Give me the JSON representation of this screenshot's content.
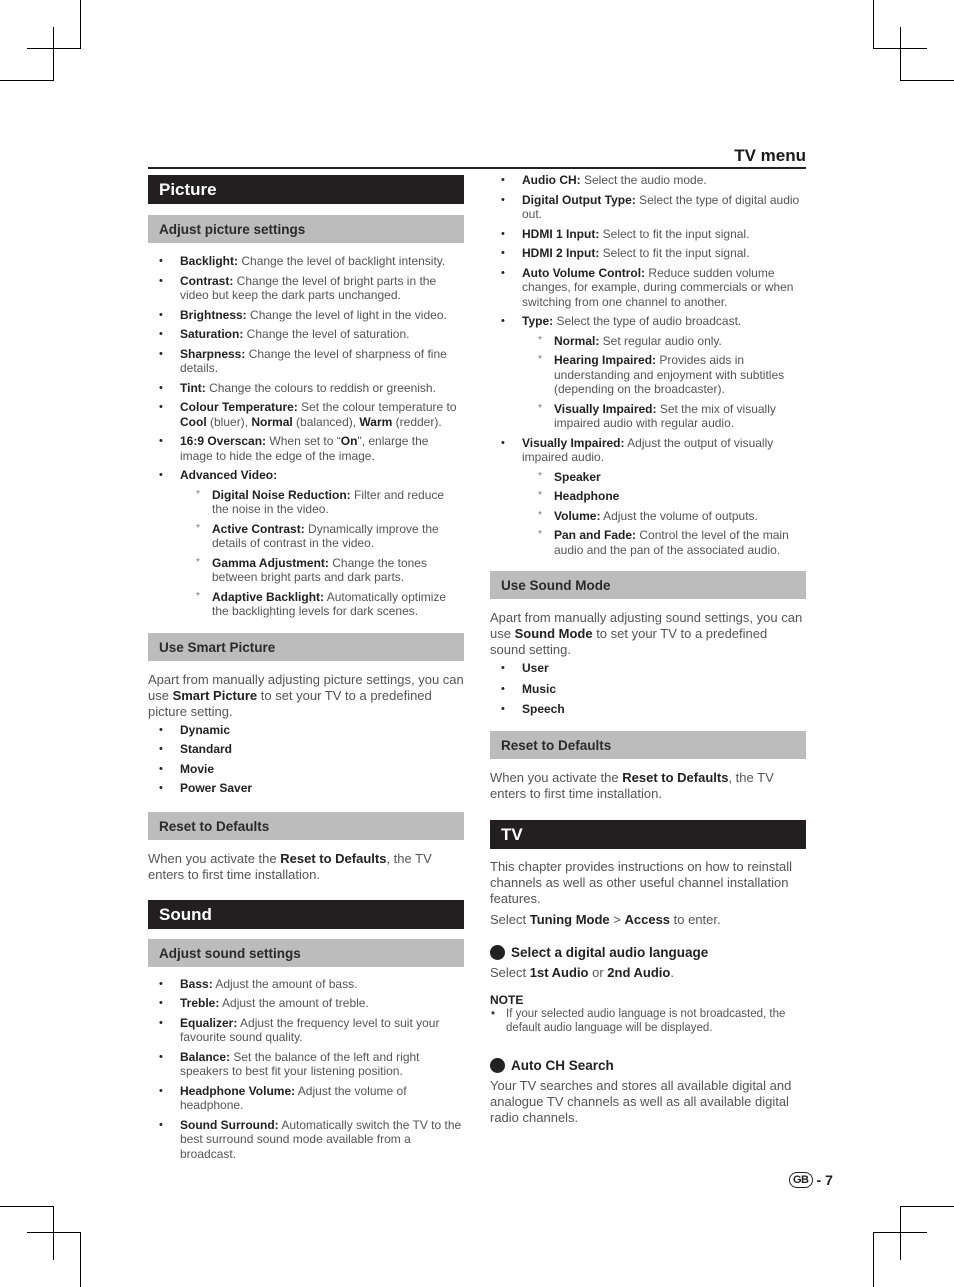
{
  "header": {
    "title": "TV menu"
  },
  "left": {
    "picture": {
      "title": "Picture",
      "adjust": {
        "title": "Adjust picture settings",
        "items": [
          {
            "label": "Backlight:",
            "text": " Change the level of backlight intensity."
          },
          {
            "label": "Contrast:",
            "text": " Change the level of bright parts in the video but keep the dark parts unchanged."
          },
          {
            "label": "Brightness:",
            "text": " Change the level of light in the video."
          },
          {
            "label": "Saturation:",
            "text": " Change the level of saturation."
          },
          {
            "label": "Sharpness:",
            "text": " Change the level of sharpness of fine details."
          },
          {
            "label": "Tint:",
            "text": " Change the colours to reddish or greenish."
          },
          {
            "label": "Colour Temperature:",
            "text": " Set the colour temperature to ",
            "parts": [
              "Cool",
              " (bluer), ",
              "Normal",
              " (balanced), ",
              "Warm",
              " (redder)."
            ]
          },
          {
            "label": "16:9 Overscan:",
            "text": " When set to “",
            "on": "On",
            "rest": "\", enlarge the image to hide the edge of the image."
          },
          {
            "label": "Advanced Video:",
            "text": ""
          }
        ],
        "advanced": [
          {
            "label": "Digital Noise Reduction:",
            "text": " Filter and reduce the noise in the video."
          },
          {
            "label": "Active Contrast:",
            "text": "  Dynamically improve the details of contrast in the video."
          },
          {
            "label": "Gamma Adjustment:",
            "text": " Change the tones between bright parts and dark parts."
          },
          {
            "label": "Adaptive Backlight:",
            "text": " Automatically optimize the backlighting levels for dark scenes."
          }
        ]
      },
      "smart": {
        "title": "Use Smart Picture",
        "p1": "Apart from manually adjusting picture settings, you can use ",
        "bold": "Smart Picture",
        "p2": " to set your TV to a predefined picture setting.",
        "options": [
          "Dynamic",
          "Standard",
          "Movie",
          "Power Saver"
        ]
      },
      "reset": {
        "title": "Reset to Defaults",
        "p1": "When you activate the ",
        "bold": "Reset to Defaults",
        "p2": ", the TV enters to first time installation."
      }
    },
    "sound": {
      "title": "Sound",
      "adjust": {
        "title": "Adjust sound settings",
        "items": [
          {
            "label": "Bass:",
            "text": " Adjust the amount of bass."
          },
          {
            "label": "Treble:",
            "text": " Adjust the amount of treble."
          },
          {
            "label": "Equalizer:",
            "text": " Adjust the frequency level to suit your favourite sound quality."
          },
          {
            "label": "Balance:",
            "text": " Set the balance of the left and right speakers to best fit your listening position."
          },
          {
            "label": "Headphone Volume:",
            "text": " Adjust the volume of headphone."
          },
          {
            "label": "Sound Surround:",
            "text": " Automatically switch the TV to the best surround sound mode available from a broadcast."
          }
        ]
      }
    }
  },
  "right": {
    "sound_items": [
      {
        "label": "Audio CH:",
        "text": " Select the audio mode."
      },
      {
        "label": "Digital Output Type:",
        "text": " Select the type of digital audio out."
      },
      {
        "label": "HDMI 1 Input:",
        "text": " Select to fit the input signal."
      },
      {
        "label": "HDMI 2 Input:",
        "text": " Select to fit the input signal."
      },
      {
        "label": "Auto Volume Control:",
        "text": " Reduce sudden volume changes, for example, during commercials or when switching from one channel to another."
      },
      {
        "label": "Type:",
        "text": " Select the type of audio broadcast."
      }
    ],
    "type_sub": [
      {
        "label": "Normal:",
        "text": " Set regular audio only."
      },
      {
        "label": "Hearing Impaired:",
        "text": " Provides aids in understanding and enjoyment with subtitles (depending on the broadcaster)."
      },
      {
        "label": "Visually Impaired:",
        "text": " Set the mix of visually impaired audio with regular audio."
      }
    ],
    "vi": {
      "label": "Visually Impaired:",
      "text": " Adjust the output of visually impaired audio."
    },
    "vi_sub": [
      {
        "label": "Speaker",
        "text": ""
      },
      {
        "label": "Headphone",
        "text": ""
      },
      {
        "label": "Volume:",
        "text": " Adjust the volume of outputs."
      },
      {
        "label": "Pan and Fade:",
        "text": " Control the level of the main audio and the pan of the associated audio."
      }
    ],
    "sound_mode": {
      "title": "Use Sound Mode",
      "p1": "Apart from manually adjusting sound settings, you can use ",
      "bold": "Sound Mode",
      "p2": " to set your TV to a predefined sound setting.",
      "options": [
        "User",
        "Music",
        "Speech"
      ]
    },
    "reset": {
      "title": "Reset to Defaults",
      "p1": "When you activate the ",
      "bold": "Reset to Defaults",
      "p2": ", the TV enters to first time installation."
    },
    "tv": {
      "title": "TV",
      "intro": "This chapter provides instructions on how to reinstall channels as well as other useful channel installation features.",
      "select_pre": "Select ",
      "tuning": "Tuning Mode",
      "gt": " > ",
      "access": "Access",
      "select_post": " to enter.",
      "lang": {
        "title": "Select a digital audio language",
        "pre": "Select ",
        "a1": "1st Audio",
        "or": " or ",
        "a2": "2nd Audio",
        "post": "."
      },
      "note": {
        "title": "NOTE",
        "text": "If your selected audio language is not broadcasted, the default audio language will be displayed."
      },
      "auto": {
        "title": "Auto CH Search",
        "text": "Your TV searches and stores all available digital and analogue TV channels as well as all available digital radio channels."
      }
    }
  },
  "footer": {
    "region": "GB",
    "sep": "-",
    "page": "7"
  }
}
